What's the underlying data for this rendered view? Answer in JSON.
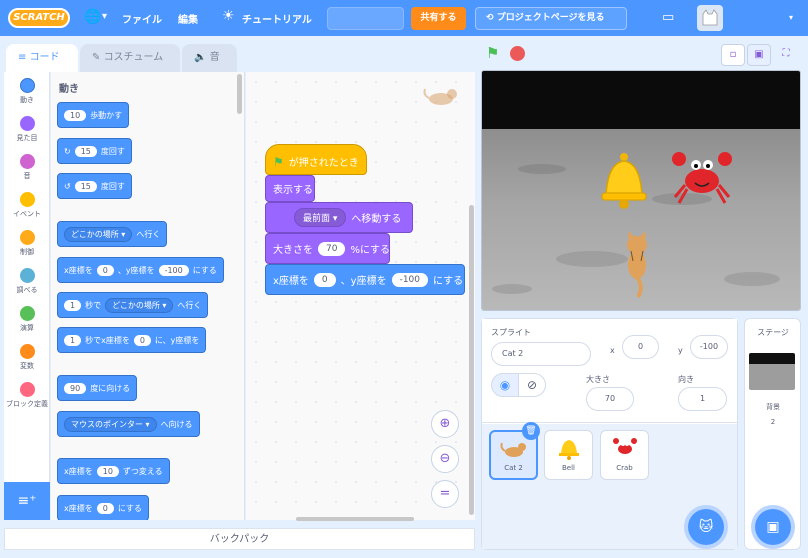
{
  "menu": {
    "logo": "SCRATCH",
    "globe_caret": "▾",
    "file": "ファイル",
    "edit": "編集",
    "tutorials": "チュートリアル",
    "share": "共有する",
    "project_page": "プロジェクトページを見る",
    "account_caret": "▾"
  },
  "tabs": {
    "code": "コード",
    "costumes": "コスチューム",
    "sounds": "音"
  },
  "categories": [
    {
      "label": "動き",
      "color": "#4c97ff"
    },
    {
      "label": "見た目",
      "color": "#9966ff"
    },
    {
      "label": "音",
      "color": "#cf63cf"
    },
    {
      "label": "イベント",
      "color": "#ffbf00"
    },
    {
      "label": "制御",
      "color": "#ffab19"
    },
    {
      "label": "調べる",
      "color": "#5cb1d6"
    },
    {
      "label": "演算",
      "color": "#59c059"
    },
    {
      "label": "変数",
      "color": "#ff8c1a"
    },
    {
      "label": "ブロック定義",
      "color": "#ff6680"
    }
  ],
  "palette": {
    "title": "動き",
    "move_n": "10",
    "move_t": "歩動かす",
    "turn_r_n": "15",
    "turn_r_t": "度回す",
    "turn_l_n": "15",
    "turn_l_t": "度回す",
    "goto_drop": "どこかの場所 ▾",
    "goto_t": "へ行く",
    "gotoxy_a": "x座標を",
    "gotoxy_x": "0",
    "gotoxy_b": "、y座標を",
    "gotoxy_y": "-100",
    "gotoxy_c": "にする",
    "glide_n": "1",
    "glide_a": "秒で",
    "glide_drop": "どこかの場所 ▾",
    "glide_t": "へ行く",
    "glidexy_n": "1",
    "glidexy_a": "秒でx座標を",
    "glidexy_x": "0",
    "glidexy_b": "に、y座標を",
    "point_n": "90",
    "point_t": "度に向ける",
    "pointto_drop": "マウスのポインター ▾",
    "pointto_t": "へ向ける",
    "changex_a": "x座標を",
    "changex_n": "10",
    "changex_t": "ずつ変える",
    "setx_a": "x座標を",
    "setx_n": "0",
    "setx_t": "にする"
  },
  "script": {
    "hat": "が押されたとき",
    "show": "表示する",
    "front_drop": "最前面 ▾",
    "front_t": "へ移動する",
    "size_a": "大きさを",
    "size_n": "70",
    "size_b": "%にする",
    "xy_a": "x座標を",
    "xy_x": "0",
    "xy_b": "、y座標を",
    "xy_y": "-100",
    "xy_c": "にする"
  },
  "backpack": "バックパック",
  "sprite_info": {
    "label": "スプライト",
    "name": "Cat 2",
    "x_label": "x",
    "x": "0",
    "y_label": "y",
    "y": "-100",
    "show_label": "表示する",
    "size_label": "大きさ",
    "size": "70",
    "dir_label": "向き",
    "dir": "1"
  },
  "sprites": [
    {
      "name": "Cat 2",
      "selected": true
    },
    {
      "name": "Bell",
      "selected": false
    },
    {
      "name": "Crab",
      "selected": false
    }
  ],
  "stage_pane": {
    "label": "ステージ",
    "backdrops_label": "背景",
    "backdrops_count": "2"
  }
}
